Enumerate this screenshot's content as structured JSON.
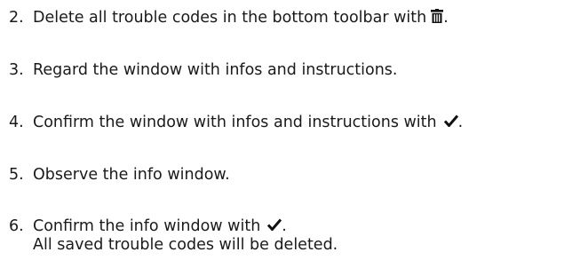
{
  "steps": [
    {
      "number": "2.",
      "text": "Delete all trouble codes in the bottom toolbar with",
      "trail_icon": "trash-icon",
      "suffix": "."
    },
    {
      "number": "3.",
      "text": "Regard the window with infos and instructions."
    },
    {
      "number": "4.",
      "text": "Confirm the window with infos and instructions with",
      "trail_icon": "checkmark-icon",
      "suffix": "."
    },
    {
      "number": "5.",
      "text": "Observe the info window."
    },
    {
      "number": "6.",
      "text": "Confirm the info window with",
      "trail_icon": "checkmark-icon",
      "suffix": ".",
      "subtext": "All saved trouble codes will be deleted."
    }
  ]
}
